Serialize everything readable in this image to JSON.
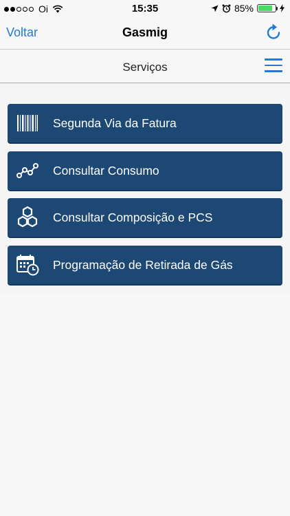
{
  "status_bar": {
    "carrier": "Oi",
    "time": "15:35",
    "battery_percent": "85%",
    "battery_level": 0.85
  },
  "nav": {
    "back_label": "Voltar",
    "title": "Gasmig"
  },
  "header": {
    "title": "Serviços"
  },
  "services": [
    {
      "label": "Segunda Via da Fatura",
      "icon": "barcode-icon"
    },
    {
      "label": "Consultar Consumo",
      "icon": "line-graph-icon"
    },
    {
      "label": "Consultar Composição e PCS",
      "icon": "hexagons-icon"
    },
    {
      "label": "Programação de Retirada de Gás",
      "icon": "calendar-clock-icon"
    }
  ],
  "colors": {
    "accent": "#1e7bd6",
    "button_bg": "#1d4873",
    "battery_green": "#4cd964"
  }
}
